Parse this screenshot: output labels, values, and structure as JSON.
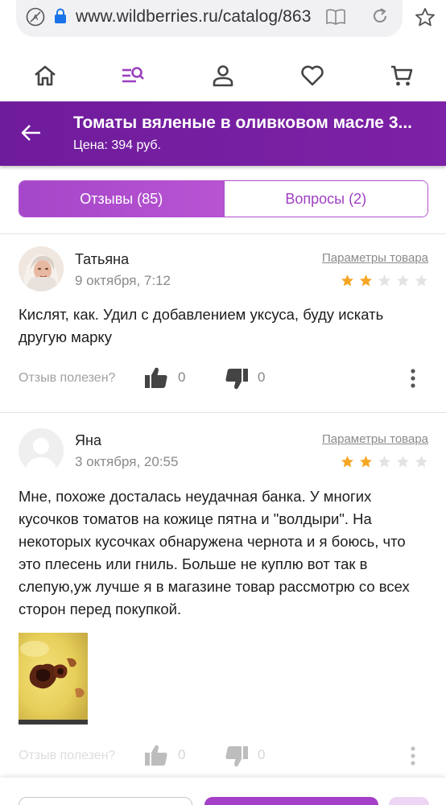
{
  "browser": {
    "url": "www.wildberries.ru/catalog/863",
    "icons": [
      "translate-icon",
      "lock-icon",
      "reader-mode-icon",
      "refresh-icon",
      "bookmark-star-icon"
    ]
  },
  "nav": {
    "icons": [
      "home-icon",
      "catalog-search-icon",
      "profile-icon",
      "favorites-icon",
      "cart-icon"
    ],
    "active": "catalog-search-icon",
    "accent": "#7b1fa2"
  },
  "header": {
    "title": "Томаты вяленые в оливковом масле 3...",
    "price": "Цена: 394 руб.",
    "background": "#7b1fa2"
  },
  "tabs": [
    {
      "label": "Отзывы (85)",
      "active": true
    },
    {
      "label": "Вопросы (2)",
      "active": false
    }
  ],
  "reviews": [
    {
      "author": "Татьяна",
      "date": "9 октября, 7:12",
      "params_link": "Параметры товара",
      "rating": 2,
      "max_rating": 5,
      "text": "Кислят, как. Удил с добавлением уксуса, буду искать другую марку",
      "helpful_label": "Отзыв полезен?",
      "likes": "0",
      "dislikes": "0"
    },
    {
      "author": "Яна",
      "date": "3 октября, 20:55",
      "params_link": "Параметры товара",
      "rating": 2,
      "max_rating": 5,
      "text": "Мне, похоже досталась неудачная банка. У многих кусочков томатов на кожице пятна и \"волдыри\". На некоторых кусочках обнаружена чернота и я боюсь, что это плесень или гниль. Больше не куплю вот так в слепую,уж лучше я в магазине товар рассмотрю со всех сторон перед покупкой.",
      "helpful_label": "Отзыв полезен?",
      "likes": "0",
      "dislikes": "0"
    }
  ],
  "colors": {
    "star_filled": "#f5a623",
    "star_empty": "#e3e3e3",
    "tab_active": "#b24fcf"
  }
}
